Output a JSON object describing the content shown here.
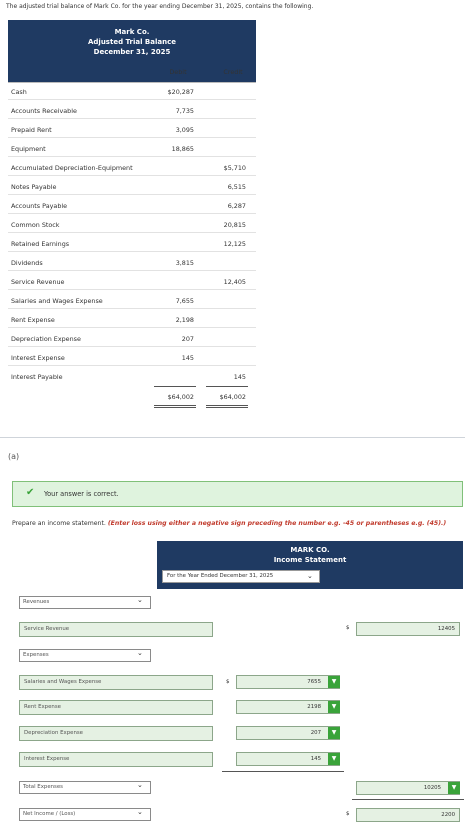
{
  "intro": "The adjusted trial balance of Mark Co. for the year ending December 31, 2025, contains the following.",
  "trial_balance": {
    "company": "Mark Co.",
    "title": "Adjusted Trial Balance",
    "date": "December 31, 2025",
    "debit_header": "Debit",
    "credit_header": "Credit",
    "rows": [
      {
        "label": "Cash",
        "debit": "$20,287",
        "credit": ""
      },
      {
        "label": "Accounts Receivable",
        "debit": "7,735",
        "credit": ""
      },
      {
        "label": "Prepaid Rent",
        "debit": "3,095",
        "credit": ""
      },
      {
        "label": "Equipment",
        "debit": "18,865",
        "credit": ""
      },
      {
        "label": "Accumulated Depreciation-Equipment",
        "debit": "",
        "credit": "$5,710"
      },
      {
        "label": "Notes Payable",
        "debit": "",
        "credit": "6,515"
      },
      {
        "label": "Accounts Payable",
        "debit": "",
        "credit": "6,287"
      },
      {
        "label": "Common Stock",
        "debit": "",
        "credit": "20,815"
      },
      {
        "label": "Retained Earnings",
        "debit": "",
        "credit": "12,125"
      },
      {
        "label": "Dividends",
        "debit": "3,815",
        "credit": ""
      },
      {
        "label": "Service Revenue",
        "debit": "",
        "credit": "12,405"
      },
      {
        "label": "Salaries and Wages Expense",
        "debit": "7,655",
        "credit": ""
      },
      {
        "label": "Rent Expense",
        "debit": "2,198",
        "credit": ""
      },
      {
        "label": "Depreciation Expense",
        "debit": "207",
        "credit": ""
      },
      {
        "label": "Interest Expense",
        "debit": "145",
        "credit": ""
      },
      {
        "label": "Interest Payable",
        "debit": "",
        "credit": "145"
      }
    ],
    "total_debit": "$64,002",
    "total_credit": "$64,002"
  },
  "part_label": "(a)",
  "feedback": {
    "check_icon": "check-icon",
    "text": "Your answer is correct."
  },
  "instruction": {
    "main": "Prepare an income statement.",
    "note": "(Enter loss using either a negative sign preceding the number e.g. -45 or parentheses e.g. (45).)"
  },
  "income_statement": {
    "company": "MARK CO.",
    "title": "Income Statement",
    "period": "For the Year Ended December 31, 2025",
    "revenues_select": "Revenues",
    "service_revenue_label": "Service Revenue",
    "service_revenue_dollar": "$",
    "service_revenue_value": "12405",
    "expenses_select": "Expenses",
    "expense_dollar": "$",
    "expenses": [
      {
        "label": "Salaries and Wages Expense",
        "value": "7655"
      },
      {
        "label": "Rent Expense",
        "value": "2198"
      },
      {
        "label": "Depreciation Expense",
        "value": "207"
      },
      {
        "label": "Interest Expense",
        "value": "145"
      }
    ],
    "total_expenses_select": "Total Expenses",
    "total_expenses_value": "10205",
    "net_income_select": "Net Income / (Loss)",
    "net_income_dollar": "$",
    "net_income_value": "2200"
  },
  "colors": {
    "header_bg": "#1f3a62",
    "correct_bg": "#dff3de",
    "correct_flag": "#3aa33a",
    "note_red": "#c0392b"
  }
}
